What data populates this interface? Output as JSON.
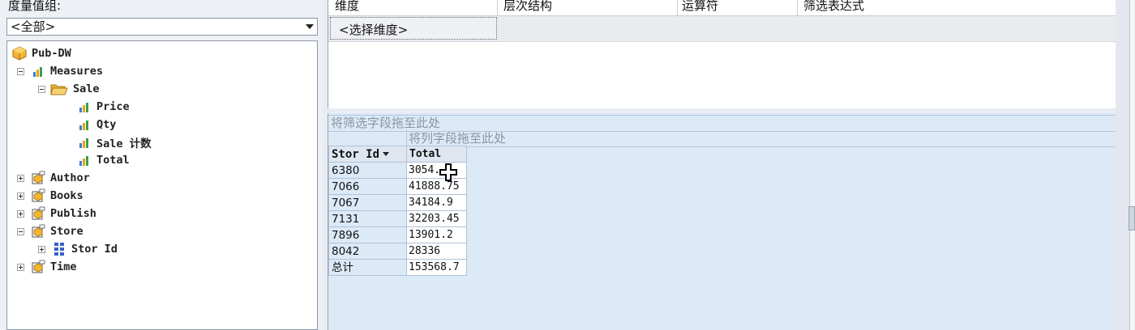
{
  "measure_group": {
    "label": "度量值组:",
    "selected": "<全部>"
  },
  "tree": {
    "root": "Pub-DW",
    "measures": "Measures",
    "sale_folder": "Sale",
    "measure_items": [
      "Price",
      "Qty",
      "Sale 计数",
      "Total"
    ],
    "dimensions": [
      "Author",
      "Books",
      "Publish",
      "Store",
      "Time"
    ],
    "store_child": "Stor Id"
  },
  "filter_grid": {
    "columns": [
      "维度",
      "层次结构",
      "运算符",
      "筛选表达式"
    ],
    "select_dimension": "<选择维度>"
  },
  "pivot": {
    "filter_drop_hint": "将筛选字段拖至此处",
    "column_drop_hint": "将列字段拖至此处",
    "row_header": "Stor Id",
    "value_header": "Total",
    "rows": [
      {
        "key": "6380",
        "value": "3054."
      },
      {
        "key": "7066",
        "value": "41888.75"
      },
      {
        "key": "7067",
        "value": "34184.9"
      },
      {
        "key": "7131",
        "value": "32203.45"
      },
      {
        "key": "7896",
        "value": "13901.2"
      },
      {
        "key": "8042",
        "value": "28336"
      },
      {
        "key": "总计",
        "value": "153568.7"
      }
    ]
  },
  "colors": {
    "pivot_bg": "#dce9f7",
    "cube_icon": "#e8a317",
    "folder_icon": "#f0c24a"
  }
}
